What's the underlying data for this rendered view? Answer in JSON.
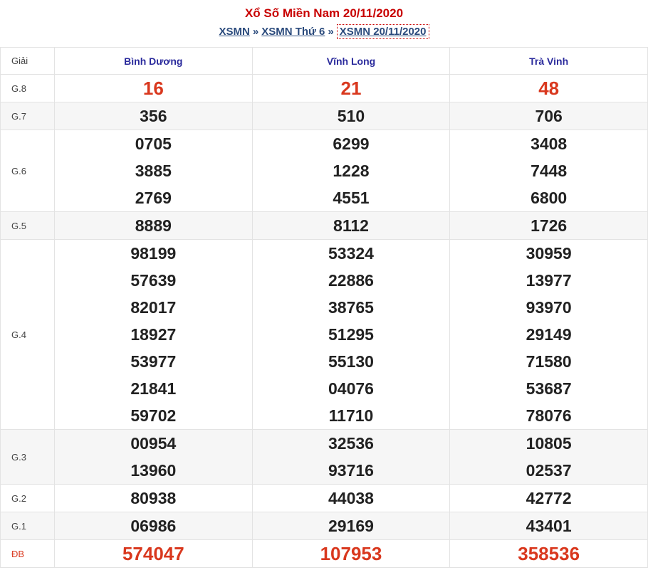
{
  "header": {
    "title": "Xổ Số Miền Nam 20/11/2020",
    "breadcrumb": [
      {
        "label": "XSMN"
      },
      {
        "label": "XSMN Thứ 6"
      },
      {
        "label": "XSMN 20/11/2020"
      }
    ],
    "separator": "»"
  },
  "table": {
    "label_header": "Giải",
    "provinces": [
      "Bình Dương",
      "Vĩnh Long",
      "Trà Vinh"
    ],
    "rows": [
      {
        "label": "G.8",
        "values": [
          [
            "16"
          ],
          [
            "21"
          ],
          [
            "48"
          ]
        ]
      },
      {
        "label": "G.7",
        "values": [
          [
            "356"
          ],
          [
            "510"
          ],
          [
            "706"
          ]
        ]
      },
      {
        "label": "G.6",
        "values": [
          [
            "0705",
            "3885",
            "2769"
          ],
          [
            "6299",
            "1228",
            "4551"
          ],
          [
            "3408",
            "7448",
            "6800"
          ]
        ]
      },
      {
        "label": "G.5",
        "values": [
          [
            "8889"
          ],
          [
            "8112"
          ],
          [
            "1726"
          ]
        ]
      },
      {
        "label": "G.4",
        "values": [
          [
            "98199",
            "57639",
            "82017",
            "18927",
            "53977",
            "21841",
            "59702"
          ],
          [
            "53324",
            "22886",
            "38765",
            "51295",
            "55130",
            "04076",
            "11710"
          ],
          [
            "30959",
            "13977",
            "93970",
            "29149",
            "71580",
            "53687",
            "78076"
          ]
        ]
      },
      {
        "label": "G.3",
        "values": [
          [
            "00954",
            "13960"
          ],
          [
            "32536",
            "93716"
          ],
          [
            "10805",
            "02537"
          ]
        ]
      },
      {
        "label": "G.2",
        "values": [
          [
            "80938"
          ],
          [
            "44038"
          ],
          [
            "42772"
          ]
        ]
      },
      {
        "label": "G.1",
        "values": [
          [
            "06986"
          ],
          [
            "29169"
          ],
          [
            "43401"
          ]
        ]
      },
      {
        "label": "ĐB",
        "values": [
          [
            "574047"
          ],
          [
            "107953"
          ],
          [
            "358536"
          ]
        ]
      }
    ]
  }
}
